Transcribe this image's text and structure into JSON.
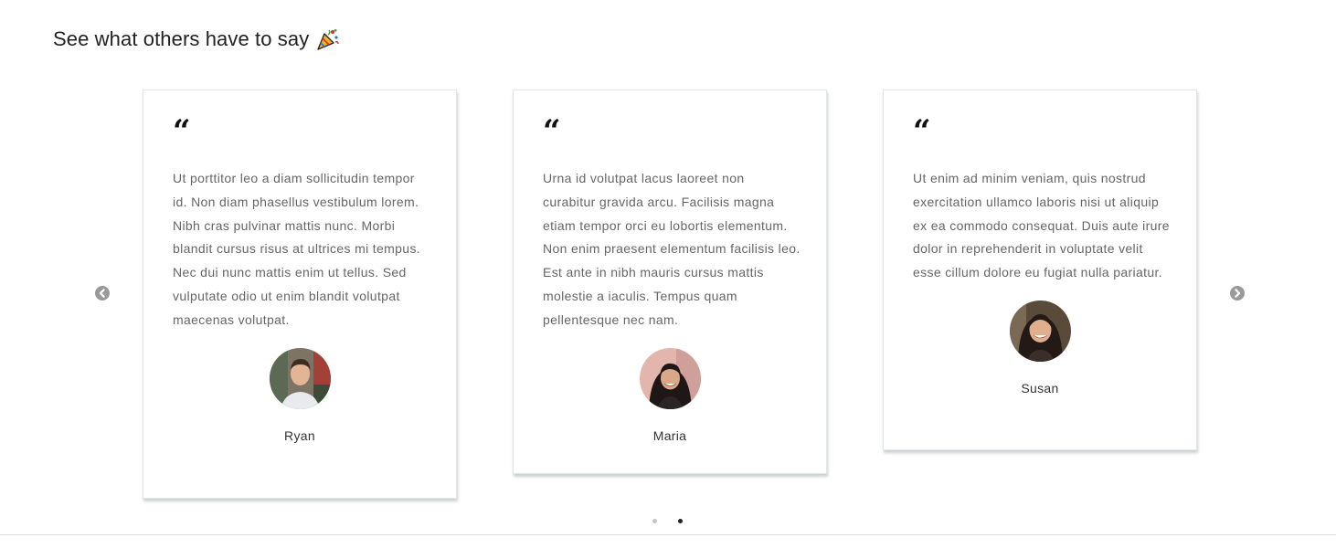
{
  "section": {
    "title": "See what others have to say",
    "title_icon": "party-popper-icon"
  },
  "testimonials": [
    {
      "quote_icon": "quote-icon",
      "text": "Ut porttitor leo a diam sollicitudin tempor id. Non diam phasellus vestibulum lorem. Nibh cras pulvinar mattis nunc. Morbi blandit cursus risus at ultrices mi tempus. Nec dui nunc mattis enim ut tellus. Sed vulputate odio ut enim blandit volutpat maecenas volutpat.",
      "name": "Ryan"
    },
    {
      "quote_icon": "quote-icon",
      "text": "Urna id volutpat lacus laoreet non curabitur gravida arcu. Facilisis magna etiam tempor orci eu lobortis elementum. Non enim praesent elementum facilisis leo. Est ante in nibh mauris cursus mattis molestie a iaculis. Tempus quam pellentesque nec nam.",
      "name": "Maria"
    },
    {
      "quote_icon": "quote-icon",
      "text": "Ut enim ad minim veniam, quis nostrud exercitation ullamco laboris nisi ut aliquip ex ea commodo consequat. Duis aute irure dolor in reprehenderit in voluptate velit esse cillum dolore eu fugiat nulla pariatur.",
      "name": "Susan"
    }
  ],
  "carousel": {
    "prev_icon": "chevron-left-circle-icon",
    "next_icon": "chevron-right-circle-icon",
    "page_count": 2,
    "active_page": 2
  },
  "colors": {
    "card_border": "#e3e6e6",
    "body_text": "#666666",
    "arrow": "#9a9a9a",
    "dot_active": "#222222",
    "dot_inactive": "#c4c4c4"
  }
}
